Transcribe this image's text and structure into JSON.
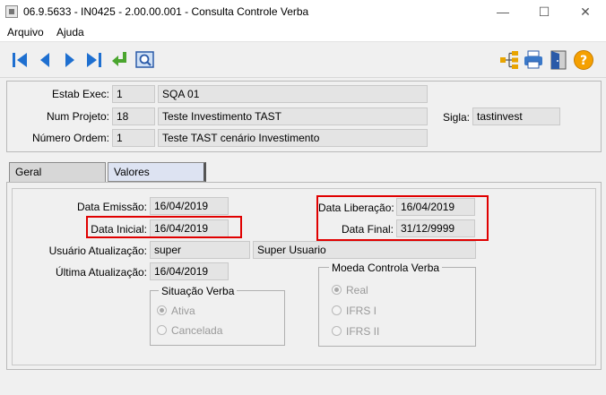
{
  "window": {
    "title": "06.9.5633 - IN0425 - 2.00.00.001 - Consulta Controle Verba",
    "minimize_glyph": "—",
    "maximize_glyph": "☐",
    "close_glyph": "✕"
  },
  "menu": [
    "Arquivo",
    "Ajuda"
  ],
  "toolbar": {
    "icons": [
      "first-record-icon",
      "previous-record-icon",
      "next-record-icon",
      "last-record-icon",
      "goto-return-icon",
      "zoom-search-icon",
      "hierarchy-icon",
      "print-icon",
      "exit-door-icon",
      "help-icon"
    ],
    "help_glyph": "?"
  },
  "header": {
    "estab_label": "Estab Exec:",
    "estab_code": "1",
    "estab_name": "SQA 01",
    "projeto_label": "Num Projeto:",
    "projeto_code": "18",
    "projeto_name": "Teste Investimento TAST",
    "sigla_label": "Sigla:",
    "sigla_value": "tastinvest",
    "ordem_label": "Número Ordem:",
    "ordem_code": "1",
    "ordem_name": "Teste TAST cenário Investimento"
  },
  "tabs": [
    {
      "label": "Geral",
      "active": true
    },
    {
      "label": "Valores",
      "active": false
    }
  ],
  "geral": {
    "emissao_label": "Data Emissão:",
    "emissao_value": "16/04/2019",
    "inicial_label": "Data Inicial:",
    "inicial_value": "16/04/2019",
    "usuario_label": "Usuário Atualização:",
    "usuario_value": "super",
    "usuario_name": "Super Usuario",
    "ultima_label": "Última Atualização:",
    "ultima_value": "16/04/2019",
    "liberacao_label": "Data Liberação:",
    "liberacao_value": "16/04/2019",
    "final_label": "Data Final:",
    "final_value": "31/12/9999",
    "situacao": {
      "title": "Situação Verba",
      "options": [
        "Ativa",
        "Cancelada"
      ],
      "selected": "Ativa"
    },
    "moeda": {
      "title": "Moeda Controla Verba",
      "options": [
        "Real",
        "IFRS I",
        "IFRS II"
      ],
      "selected": "Real"
    }
  },
  "colors": {
    "highlight_red": "#e00000",
    "tab_active": "#d7d7d7",
    "tab_inactive": "#dde3f2",
    "nav_blue": "#1e6fd0",
    "help_orange": "#f5a000"
  }
}
